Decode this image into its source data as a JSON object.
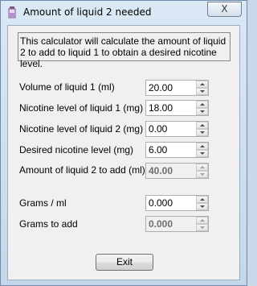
{
  "window": {
    "title": "Amount of liquid 2 needed",
    "close_label": "X",
    "app_icon": "liquid-bottle-icon"
  },
  "description": "This calculator will calculate the amount of liquid 2 to add to liquid 1 to obtain a desired nicotine level.",
  "fields": [
    {
      "label": "Volume of liquid 1 (ml)",
      "value": "20.00",
      "readonly": false
    },
    {
      "label": "Nicotine level of liquid 1 (mg)",
      "value": "18.00",
      "readonly": false
    },
    {
      "label": "Nicotine level of liquid 2 (mg)",
      "value": "0.00",
      "readonly": false
    },
    {
      "label": "Desired nicotine level (mg)",
      "value": "6.00",
      "readonly": false
    },
    {
      "label": "Amount of liquid 2 to add (ml)",
      "value": "40.00",
      "readonly": true
    },
    {
      "label": "Grams / ml",
      "value": "0.000",
      "readonly": false
    },
    {
      "label": "Grams to add",
      "value": "0.000",
      "readonly": true
    }
  ],
  "exit_label": "Exit"
}
